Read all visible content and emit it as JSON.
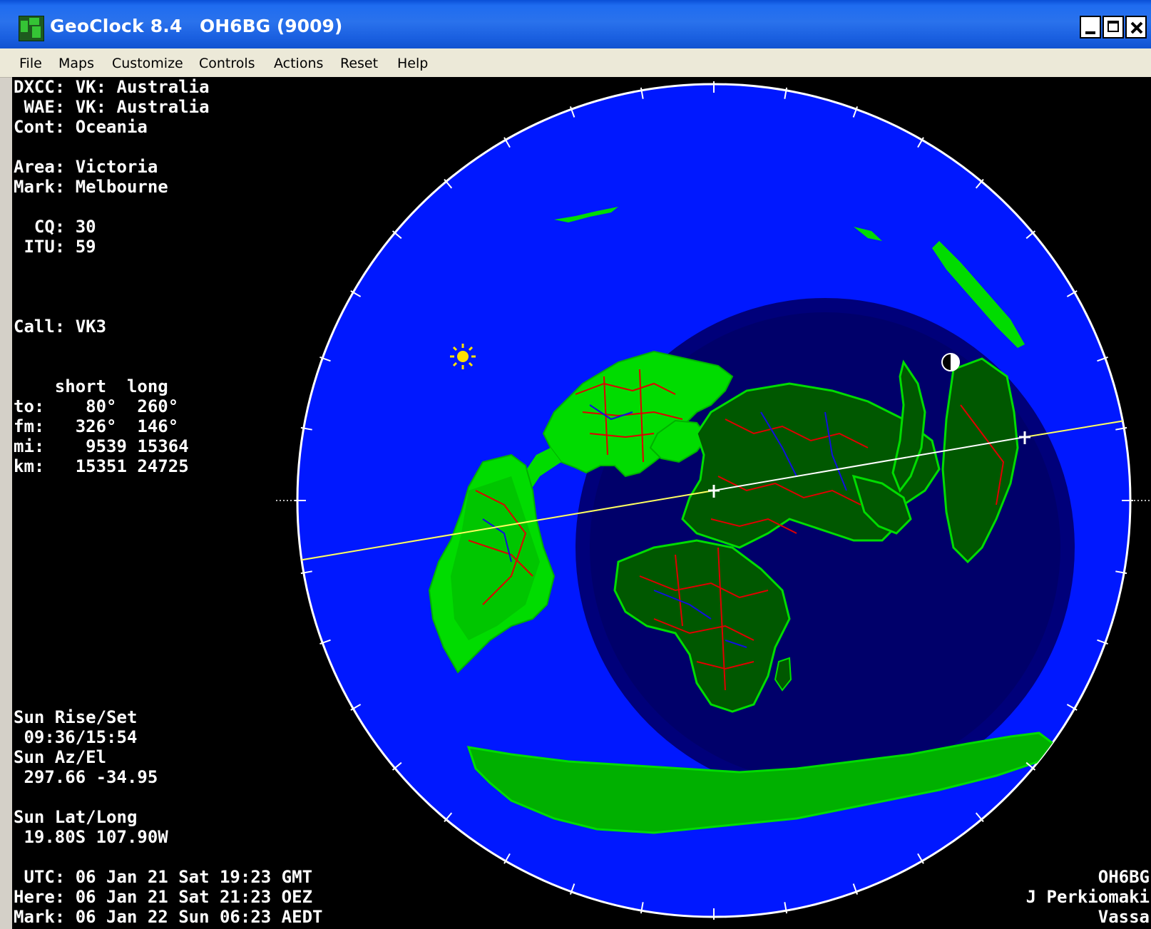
{
  "window": {
    "app_title": "GeoClock 8.4",
    "call_title": "OH6BG  (9009)"
  },
  "menu": [
    "File",
    "Maps",
    "Customize",
    "Controls",
    "Actions",
    "Reset",
    "Help"
  ],
  "info": {
    "dxcc": "DXCC: VK: Australia",
    "wae": " WAE: VK: Australia",
    "cont": "Cont: Oceania",
    "area": "Area: Victoria",
    "mark": "Mark: Melbourne",
    "cq": "  CQ: 30",
    "itu": " ITU: 59",
    "call": "Call: VK3",
    "table_header": "    short  long",
    "to": "to:    80°  260°",
    "fm": "fm:   326°  146°",
    "mi": "mi:    9539 15364",
    "km": "km:   15351 24725",
    "sun_rise_label": "Sun Rise/Set",
    "sun_rise_value": " 09:36/15:54",
    "sun_az_label": "Sun Az/El",
    "sun_az_value": " 297.66 -34.95",
    "sun_lat_label": "Sun Lat/Long",
    "sun_lat_value": " 19.80S 107.90W",
    "utc": " UTC: 06 Jan 21 Sat 19:23 GMT",
    "here": "Here: 06 Jan 21 Sat 21:23 OEZ",
    "mark_time": "Mark: 06 Jan 22 Sun 06:23 AEDT"
  },
  "credits": {
    "call": "OH6BG",
    "name": "J Perkiomaki",
    "city": "Vassa"
  },
  "colors": {
    "ocean": "#0018ff",
    "night": "#00006e",
    "land": "#00dc00",
    "land_night": "#005800",
    "borders": "#e00000",
    "rivers": "#1010e0",
    "path_short": "#ffffff",
    "path_long": "#ffff60"
  },
  "icons": [
    "sun-icon",
    "moon-icon",
    "home-marker-icon",
    "target-marker-icon"
  ]
}
